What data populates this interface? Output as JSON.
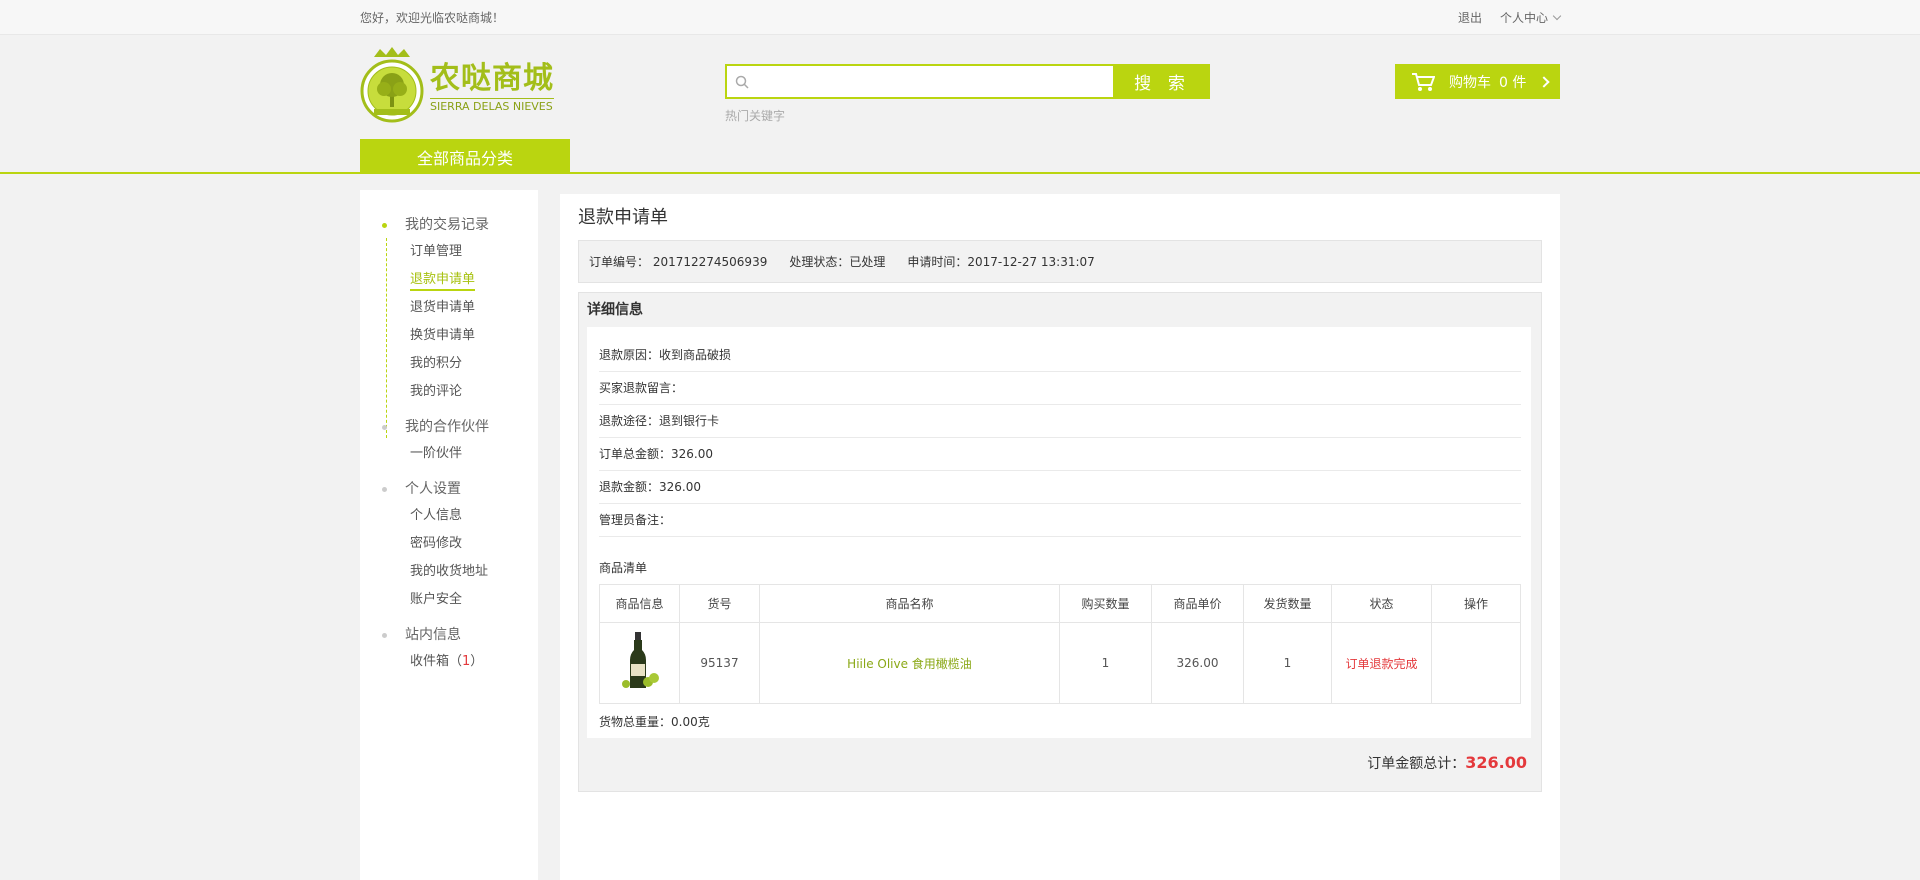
{
  "topbar": {
    "welcome": "您好，欢迎光临农哒商城！",
    "logout": "退出",
    "personal_center": "个人中心"
  },
  "logo": {
    "cn": "农哒商城",
    "en": "SIERRA DELAS NIEVES"
  },
  "search": {
    "button": "搜 索",
    "placeholder": "",
    "hot_label": "热门关键字"
  },
  "cart": {
    "label": "购物车",
    "count": "0 件"
  },
  "all_categories": "全部商品分类",
  "sidebar": {
    "sections": [
      {
        "title": "我的交易记录",
        "items": [
          "订单管理",
          "退款申请单",
          "退货申请单",
          "换货申请单",
          "我的积分",
          "我的评论"
        ]
      },
      {
        "title": "我的合作伙伴",
        "items": [
          "一阶伙伴"
        ]
      },
      {
        "title": "个人设置",
        "items": [
          "个人信息",
          "密码修改",
          "我的收货地址",
          "账户安全"
        ]
      },
      {
        "title": "站内信息",
        "inbox_label": "收件箱（",
        "inbox_count": "1",
        "inbox_suffix": "）"
      }
    ]
  },
  "main": {
    "title": "退款申请单",
    "order_no": "订单编号： 201712274506939",
    "status": "处理状态：已处理",
    "apply_time": "申请时间：2017-12-27   13:31:07",
    "detail_title": "详细信息",
    "rows": [
      "退款原因：收到商品破损",
      "买家退款留言：",
      "退款途径：退到银行卡",
      "订单总金额：326.00",
      "退款金额：326.00",
      "管理员备注："
    ],
    "goods_title": "商品清单",
    "columns": [
      "商品信息",
      "货号",
      "商品名称",
      "购买数量",
      "商品单价",
      "发货数量",
      "状态",
      "操作"
    ],
    "goods": [
      {
        "sku": "95137",
        "name": "Hiile Olive 食用橄榄油",
        "qty": "1",
        "price": "326.00",
        "shipped": "1",
        "status": "订单退款完成",
        "action": ""
      }
    ],
    "weight": "货物总重量：0.00克",
    "total_label": "订单金额总计：",
    "total_amount": "326.00"
  },
  "colors": {
    "accent": "#bad510",
    "price_red": "#e4393c"
  }
}
